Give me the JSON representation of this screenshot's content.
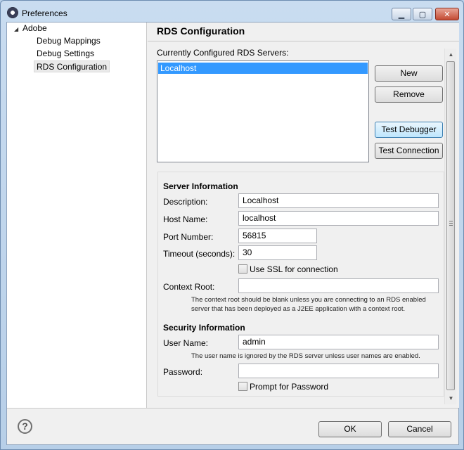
{
  "window": {
    "title": "Preferences"
  },
  "titlebar": {
    "minimize": "▁",
    "maximize": "▢",
    "close": "✕"
  },
  "tree": {
    "root": "Adobe",
    "items": [
      "Debug Mappings",
      "Debug Settings",
      "RDS Configuration"
    ],
    "selected": "RDS Configuration"
  },
  "page": {
    "title": "RDS Configuration",
    "servers_label": "Currently Configured RDS Servers:",
    "servers": [
      "Localhost"
    ],
    "buttons": {
      "new": "New",
      "remove": "Remove",
      "test_debugger": "Test Debugger",
      "test_connection": "Test Connection"
    },
    "server_info": {
      "heading": "Server Information",
      "description_label": "Description:",
      "description_value": "Localhost",
      "host_label": "Host Name:",
      "host_value": "localhost",
      "port_label": "Port Number:",
      "port_value": "56815",
      "timeout_label": "Timeout (seconds):",
      "timeout_value": "30",
      "ssl_label": "Use SSL for connection",
      "context_label": "Context Root:",
      "context_value": "",
      "context_note_1": "The context root should be blank unless you are connecting to an RDS enabled",
      "context_note_2": "server that has been deployed as a J2EE application with a context root."
    },
    "security_info": {
      "heading": "Security Information",
      "user_label": "User Name:",
      "user_value": "admin",
      "user_note": "The user name is ignored by the RDS server unless user names are enabled.",
      "password_label": "Password:",
      "password_value": "",
      "prompt_label": "Prompt for Password"
    }
  },
  "footer": {
    "help": "?",
    "ok": "OK",
    "cancel": "Cancel"
  }
}
